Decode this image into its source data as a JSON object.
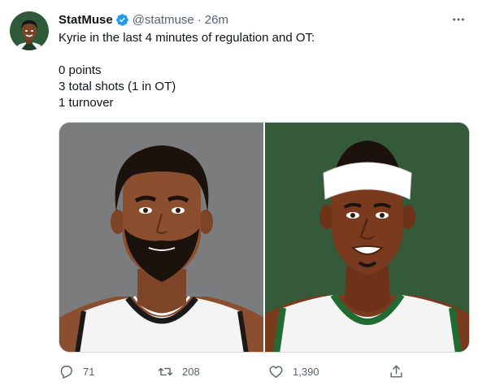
{
  "tweet": {
    "display_name": "StatMuse",
    "handle": "@statmuse",
    "separator": "·",
    "time": "26m",
    "text_lines": [
      "Kyrie in the last 4 minutes of regulation and OT:",
      "",
      "0 points",
      "3 total shots (1 in OT)",
      "1 turnover"
    ],
    "icons": {
      "avatar": "avatar",
      "verified": "verified-badge-icon",
      "more": "more-options-icon",
      "reply": "reply-icon",
      "retweet": "retweet-icon",
      "like": "like-icon",
      "share": "share-icon"
    },
    "media": {
      "left_panel": "kyrie-illustration",
      "right_panel": "celtics-player-illustration"
    }
  },
  "actions": {
    "reply_count": "71",
    "retweet_count": "208",
    "like_count": "1,390"
  },
  "colors": {
    "verified": "#1d9bf0",
    "secondary_text": "#536471",
    "left_bg": "#7a7c7d",
    "right_bg": "#345a3a"
  }
}
